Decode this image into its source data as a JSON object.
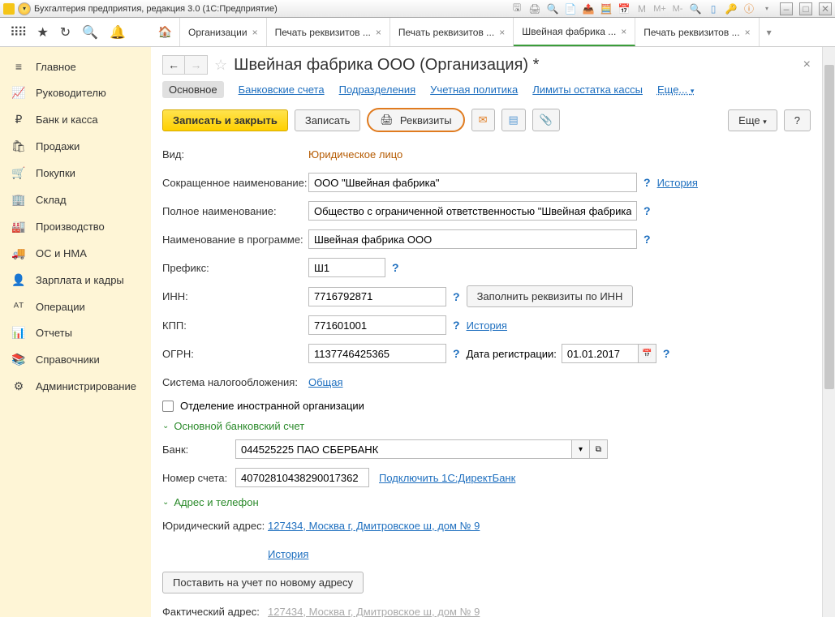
{
  "title_bar": {
    "app_title": "Бухгалтерия предприятия, редакция 3.0  (1С:Предприятие)",
    "m_labels": [
      "M",
      "M+",
      "M-"
    ]
  },
  "tabs": [
    {
      "label": "Организации"
    },
    {
      "label": "Печать реквизитов ..."
    },
    {
      "label": "Печать реквизитов ..."
    },
    {
      "label": "Швейная фабрика ...",
      "active": true
    },
    {
      "label": "Печать реквизитов ..."
    }
  ],
  "nav": [
    {
      "icon": "≡",
      "label": "Главное"
    },
    {
      "icon": "📈",
      "label": "Руководителю"
    },
    {
      "icon": "₽",
      "label": "Банк и касса"
    },
    {
      "icon": "🛍",
      "label": "Продажи"
    },
    {
      "icon": "🛒",
      "label": "Покупки"
    },
    {
      "icon": "🏢",
      "label": "Склад"
    },
    {
      "icon": "🏭",
      "label": "Производство"
    },
    {
      "icon": "🚚",
      "label": "ОС и НМА"
    },
    {
      "icon": "👤",
      "label": "Зарплата и кадры"
    },
    {
      "icon": "ᴬᵀ",
      "label": "Операции"
    },
    {
      "icon": "📊",
      "label": "Отчеты"
    },
    {
      "icon": "📚",
      "label": "Справочники"
    },
    {
      "icon": "⚙",
      "label": "Администрирование"
    }
  ],
  "page": {
    "title": "Швейная фабрика ООО (Организация) *",
    "link_tabs": {
      "main": "Основное",
      "bank": "Банковские счета",
      "subdiv": "Подразделения",
      "policy": "Учетная политика",
      "limits": "Лимиты остатка кассы",
      "more": "Еще..."
    },
    "buttons": {
      "save_close": "Записать и закрыть",
      "save": "Записать",
      "requisites": "Реквизиты",
      "more": "Еще",
      "help": "?"
    },
    "form": {
      "type_label": "Вид:",
      "type_value": "Юридическое лицо",
      "short_name_label": "Сокращенное наименование:",
      "short_name_value": "ООО \"Швейная фабрика\"",
      "history": "История",
      "full_name_label": "Полное наименование:",
      "full_name_value": "Общество с ограниченной ответственностью \"Швейная фабрика\"",
      "program_name_label": "Наименование в программе:",
      "program_name_value": "Швейная фабрика ООО",
      "prefix_label": "Префикс:",
      "prefix_value": "Ш1",
      "inn_label": "ИНН:",
      "inn_value": "7716792871",
      "fill_by_inn": "Заполнить реквизиты по ИНН",
      "kpp_label": "КПП:",
      "kpp_value": "771601001",
      "ogrn_label": "ОГРН:",
      "ogrn_value": "1137746425365",
      "reg_date_label": "Дата регистрации:",
      "reg_date_value": "01.01.2017",
      "tax_system_label": "Система налогообложения:",
      "tax_system_value": "Общая",
      "foreign_branch": "Отделение иностранной организации",
      "bank_section": "Основной банковский счет",
      "bank_label": "Банк:",
      "bank_value": "044525225 ПАО СБЕРБАНК",
      "account_label": "Номер счета:",
      "account_value": "40702810438290017362",
      "connect_direct": "Подключить 1С:ДиректБанк",
      "address_section": "Адрес и телефон",
      "legal_addr_label": "Юридический адрес:",
      "legal_addr_value": "127434, Москва г, Дмитровское ш, дом № 9",
      "new_addr_btn": "Поставить на учет по новому адресу",
      "actual_addr_label": "Фактический адрес:",
      "actual_addr_value": "127434, Москва г, Дмитровское ш, дом № 9"
    }
  }
}
